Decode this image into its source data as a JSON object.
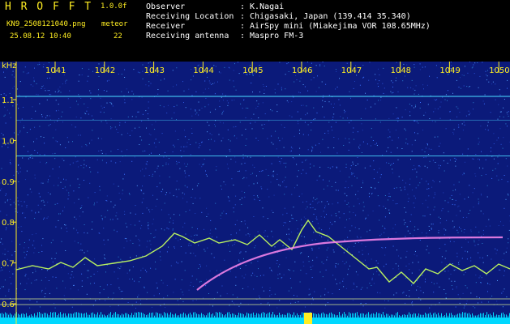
{
  "header": {
    "app_title": "H R O F F T",
    "version": "1.0.0f",
    "filename": "KN9_2508121040.png",
    "meteor_label": "meteor",
    "meteor_count": "22",
    "timestamp": "25.08.12 10:40",
    "info": [
      {
        "label": "Observer",
        "value": ": K.Nagai"
      },
      {
        "label": "Receiving Location",
        "value": ": Chigasaki, Japan (139.414 35.340)"
      },
      {
        "label": "Receiver",
        "value": ": AirSpy mini (Miakejima VOR 108.65MHz)"
      },
      {
        "label": "Receiving antenna",
        "value": ": Maspro FM-3"
      }
    ]
  },
  "plot": {
    "y_unit": "kHz",
    "x_ticks": [
      "1041",
      "1042",
      "1043",
      "1044",
      "1045",
      "1046",
      "1047",
      "1048",
      "1049",
      "1050"
    ],
    "y_ticks": [
      "1.1",
      "1.0",
      "0.9",
      "0.8",
      "0.7",
      "0.6"
    ],
    "y_tick_values": [
      1.1,
      1.0,
      0.9,
      0.8,
      0.7,
      0.6
    ],
    "colors": {
      "background": "#0b1a7a",
      "text": "#ffee22",
      "carrier": "#4ad8ff",
      "trace": "#b8f060",
      "meteor": "#ff88ee",
      "baseline": "#00d8ff"
    }
  }
}
